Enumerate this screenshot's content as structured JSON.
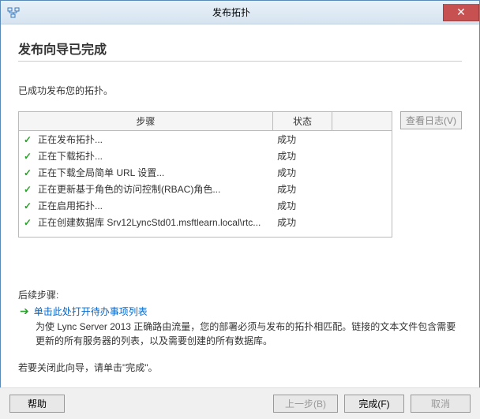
{
  "window": {
    "title": "发布拓扑",
    "close_glyph": "✕"
  },
  "header": {
    "title": "发布向导已完成"
  },
  "success_message": "已成功发布您的拓扑。",
  "table": {
    "col_step": "步骤",
    "col_status": "状态",
    "rows": [
      {
        "step": "正在发布拓扑...",
        "status": "成功"
      },
      {
        "step": "正在下载拓扑...",
        "status": "成功"
      },
      {
        "step": "正在下载全局简单 URL 设置...",
        "status": "成功"
      },
      {
        "step": "正在更新基于角色的访问控制(RBAC)角色...",
        "status": "成功"
      },
      {
        "step": "正在启用拓扑...",
        "status": "成功"
      },
      {
        "step": "正在创建数据库 Srv12LyncStd01.msftlearn.local\\rtc...",
        "status": "成功"
      }
    ]
  },
  "viewlog": {
    "label": "查看日志(V)"
  },
  "next": {
    "label": "后续步骤:",
    "link": "单击此处打开待办事项列表",
    "desc": "为使 Lync Server 2013 正确路由流量，您的部署必须与发布的拓扑相匹配。链接的文本文件包含需要更新的所有服务器的列表，以及需要创建的所有数据库。"
  },
  "close_hint": "若要关闭此向导，请单击\"完成\"。",
  "buttons": {
    "help": "帮助",
    "back": "上一步(B)",
    "finish": "完成(F)",
    "cancel": "取消"
  }
}
